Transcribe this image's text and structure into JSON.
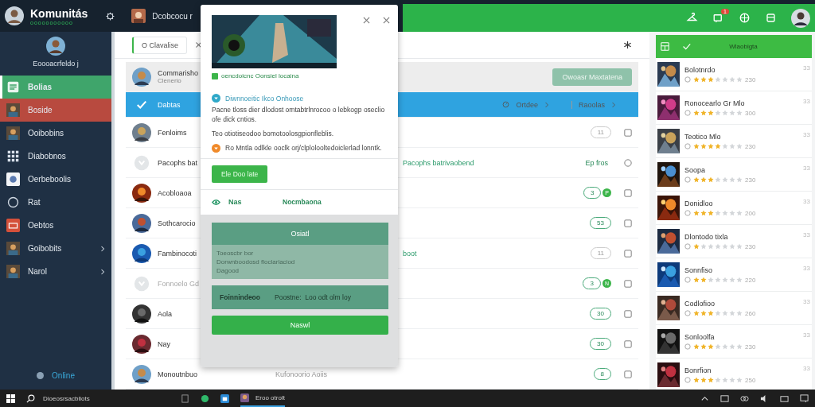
{
  "app": {
    "title": "Komunitás",
    "subtitle": "ooooooooooo",
    "account": "Dcobcocu r"
  },
  "top_icons": [
    {
      "kind": "hanger"
    },
    {
      "kind": "chat",
      "badge": "1"
    },
    {
      "kind": "globe"
    },
    {
      "kind": "window"
    }
  ],
  "profile": {
    "name": "Eoooacrfeldo j"
  },
  "sidebar": {
    "items": [
      {
        "label": "Bolias",
        "selected": true,
        "color": "#3fa56b",
        "kind": "list",
        "chevron": false
      },
      {
        "label": "Boside",
        "selected": false,
        "color": "#b84a3f",
        "kind": "picture",
        "chevron": false
      },
      {
        "label": "Ooibobins",
        "selected": false,
        "kind": "picture",
        "chevron": false
      },
      {
        "label": "Diabobnos",
        "selected": false,
        "kind": "grid",
        "chevron": false
      },
      {
        "label": "Oerbeboolis",
        "selected": false,
        "kind": "badge",
        "chevron": false
      },
      {
        "label": "Rat",
        "selected": false,
        "kind": "circle",
        "chevron": false
      },
      {
        "label": "Oebtos",
        "selected": false,
        "kind": "box",
        "chevron": false
      },
      {
        "label": "Goibobits",
        "selected": false,
        "kind": "picture",
        "chevron": true
      },
      {
        "label": "Narol",
        "selected": false,
        "kind": "picture",
        "chevron": true
      }
    ],
    "status": "Online"
  },
  "main": {
    "tab": "O Clavalise",
    "action": "Owoasr Maxtatena",
    "sort_1": "Ortdee",
    "sort_2": "Raoolas",
    "rows": [
      {
        "name": "Commarisho",
        "sub": "Clenerio",
        "kind": "avatar",
        "selected": false
      },
      {
        "name": "Dabtas",
        "kind": "check",
        "selected": true
      },
      {
        "name": "Fenloims",
        "kind": "avatar",
        "selected": false,
        "badge": "11",
        "badge_on": false
      },
      {
        "name": "Pacophs bat",
        "kind": "placeholder",
        "selected": false,
        "tag": "Pacophs batrivaobend",
        "note": "Ep fros"
      },
      {
        "name": "Acobloaoa",
        "kind": "avatar",
        "selected": false,
        "badge": "3",
        "badge_on": true,
        "dot": "P"
      },
      {
        "name": "Sothcarocio",
        "kind": "avatar",
        "selected": false,
        "badge": "53",
        "badge_on": true
      },
      {
        "name": "Fambinocoti",
        "kind": "avatar",
        "selected": false,
        "tag": "boot",
        "badge": "11",
        "badge_on": false
      },
      {
        "name": "Fonnoelo Gd",
        "kind": "placeholder",
        "selected": false,
        "badge": "3",
        "badge_on": true,
        "dot": "N"
      },
      {
        "name": "Aola",
        "kind": "avatar",
        "selected": false,
        "badge": "30",
        "badge_on": true
      },
      {
        "name": "Nay",
        "kind": "avatar",
        "selected": false,
        "badge": "30",
        "badge_on": true
      },
      {
        "name": "Monoutnbuo",
        "kind": "avatar",
        "selected": false,
        "extra": "Kufonoorio Aoiis",
        "badge": "8",
        "badge_on": true
      }
    ]
  },
  "dialog": {
    "source": "oencdoicnc Oonsiel locaina",
    "heading": "Diwnnoeitic Ikco Onhoose",
    "paragraphs": [
      "Pacne tloss dier dlodost omtabtrlnrocoo o lebkogp oseclio ofe dick cntios.",
      "Teo otiotiseodoo bomotoolosgpionfleblis."
    ],
    "warning": "Ro Mntla odlkle ooclk orj/clplolooltedoiclerlad lonntk.",
    "button": "Ele Doo late",
    "option": "Nas",
    "option_value": "Nocmbaona",
    "panel": {
      "title": "Osiatl",
      "lines": [
        "Toeoscbr bor",
        "Dorwnboodosd floclarlaciod",
        "Dagood"
      ]
    },
    "card": {
      "label": "Foinnindeoo",
      "value": "Poostne:  Loo odt olm loy"
    },
    "submit": "Naswl"
  },
  "games": {
    "header": "Wlaobigta",
    "items": [
      {
        "title": "Bolotnrdo",
        "stars": 3,
        "reading": "230",
        "code": "33"
      },
      {
        "title": "Ronocearlo Gr Mlo",
        "stars": 3,
        "reading": "300",
        "code": "33"
      },
      {
        "title": "Teotico Mlo",
        "stars": 4,
        "reading": "230",
        "code": "33"
      },
      {
        "title": "Soopa",
        "stars": 3,
        "reading": "230",
        "code": "33"
      },
      {
        "title": "Donidloo",
        "stars": 3,
        "reading": "200",
        "code": "33"
      },
      {
        "title": "Dlontodo tixla",
        "stars": 1,
        "reading": "230",
        "code": "33"
      },
      {
        "title": "Sonnfiso",
        "stars": 2,
        "reading": "220",
        "code": "33"
      },
      {
        "title": "Codlofioo",
        "stars": 3,
        "reading": "260",
        "code": "33"
      },
      {
        "title": "Sonloolfa",
        "stars": 3,
        "reading": "230",
        "code": "33"
      },
      {
        "title": "Bonrfion",
        "stars": 3,
        "reading": "250",
        "code": "33"
      }
    ]
  },
  "taskbar": {
    "search": "Dioeosrsacbliots",
    "app": "Eroo otrolt"
  }
}
